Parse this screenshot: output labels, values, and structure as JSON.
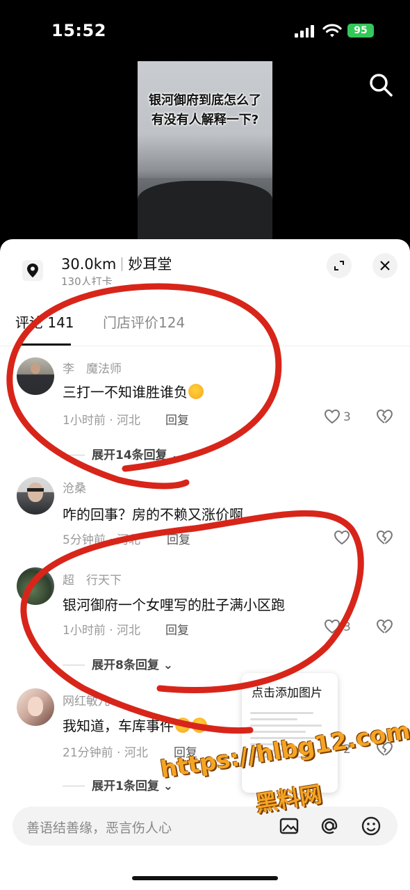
{
  "status_bar": {
    "time": "15:52",
    "battery": "95"
  },
  "video": {
    "caption_line1": "银河御府到底怎么了",
    "caption_line2": "有没有人解释一下?"
  },
  "location": {
    "distance": "30.0km",
    "name": "妙耳堂",
    "checkins": "130人打卡"
  },
  "tabs": [
    {
      "label": "评论 141",
      "active": true
    },
    {
      "label": "门店评价124",
      "active": false
    }
  ],
  "comments": [
    {
      "user": "李　魔法师",
      "text": "三打一不知谁胜谁负",
      "meta": "1小时前 · 河北",
      "reply": "回复",
      "likes": "3",
      "expand": "展开14条回复"
    },
    {
      "user": "沧桑",
      "text": "咋的回事？房的不赖又涨价啊",
      "meta": "5分钟前 · 河北",
      "reply": "回复",
      "likes": "",
      "expand": ""
    },
    {
      "user": "超　行天下",
      "text": "银河御府一个女哩写的肚子满小区跑",
      "meta": "1小时前 · 河北",
      "reply": "回复",
      "likes": "3",
      "expand": "展开8条回复"
    },
    {
      "user": "网红敏儿",
      "text": "我知道，车库事件",
      "meta": "21分钟前 · 河北",
      "reply": "回复",
      "likes": "2",
      "expand": "展开1条回复"
    }
  ],
  "image_popup": {
    "title": "点击添加图片"
  },
  "input": {
    "placeholder": "善语结善缘，恶言伤人心"
  },
  "watermark": {
    "url": "https://hlbg12.com",
    "text": "黑料网"
  },
  "colors": {
    "annotation": "#d8251a",
    "watermark": "#f5a524",
    "battery": "#34c759"
  }
}
